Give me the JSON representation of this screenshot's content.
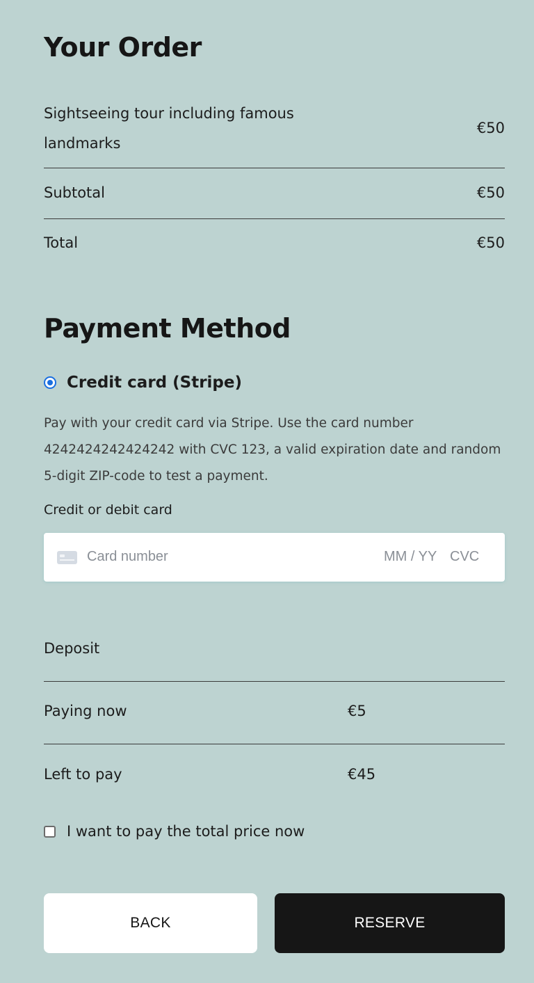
{
  "order": {
    "title": "Your Order",
    "item": {
      "name": "Sightseeing tour including famous landmarks",
      "price": "€50"
    },
    "subtotal": {
      "label": "Subtotal",
      "value": "€50"
    },
    "total": {
      "label": "Total",
      "value": "€50"
    }
  },
  "payment": {
    "title": "Payment Method",
    "option_label": "Credit card (Stripe)",
    "description": "Pay with your credit card via Stripe. Use the card number 4242424242424242 with CVC 123, a valid expiration date and random 5-digit ZIP-code to test a payment.",
    "card_label": "Credit or debit card",
    "card_number_placeholder": "Card number",
    "expiry_placeholder": "MM / YY",
    "cvc_placeholder": "CVC"
  },
  "deposit": {
    "label": "Deposit",
    "paying_now_label": "Paying now",
    "paying_now_value": "€5",
    "left_to_pay_label": "Left to pay",
    "left_to_pay_value": "€45",
    "pay_total_label": "I want to pay the total price now"
  },
  "buttons": {
    "back": "BACK",
    "reserve": "RESERVE"
  },
  "colors": {
    "background": "#bdd3d1",
    "radio_accent": "#1a6fe0",
    "reserve_button": "#161616"
  }
}
